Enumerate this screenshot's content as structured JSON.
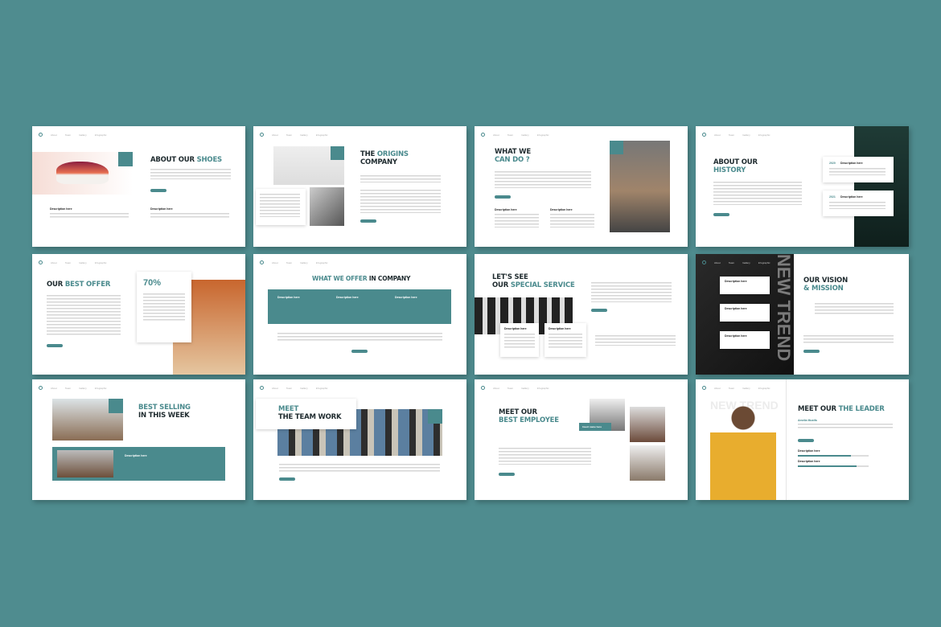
{
  "colors": {
    "background": "#4f8c8f",
    "accent": "#4a8a8d",
    "text": "#1e2a2e"
  },
  "nav": [
    "About",
    "Team",
    "Gallery",
    "Infographic"
  ],
  "slides": [
    {
      "title_a": "ABOUT OUR ",
      "title_b": "SHOES",
      "desc1": "Description here",
      "desc2": "Description here"
    },
    {
      "title_a": "THE ",
      "title_b": "ORIGINS",
      "title_c": "COMPANY"
    },
    {
      "title_a": "WHAT WE",
      "title_b": "CAN DO ?",
      "desc1": "Description here",
      "desc2": "Description here"
    },
    {
      "title_a": "ABOUT OUR",
      "title_b": "HISTORY",
      "year1": "2020",
      "year2": "2021",
      "desc": "Description here"
    },
    {
      "title_a": "OUR ",
      "title_b": "BEST OFFER",
      "stat": "70%"
    },
    {
      "title_a": "WHAT WE OFFER ",
      "title_b": "IN COMPANY",
      "desc": "Description here"
    },
    {
      "title_a": "LET'S SEE",
      "title_b": "OUR ",
      "title_c": "SPECIAL SERVICE",
      "desc": "Description here"
    },
    {
      "title_a": "OUR VISION",
      "title_b": "& MISSION",
      "desc": "Description here",
      "watermark": "NEW TREND"
    },
    {
      "title_a": "BEST SELLING",
      "title_b": "IN THIS WEEK",
      "desc": "Description here"
    },
    {
      "title_a": "MEET",
      "title_b": "THE TEAM WORK"
    },
    {
      "title_a": "MEET OUR",
      "title_b": "BEST EMPLOYEE",
      "badge": "Insert name here"
    },
    {
      "title_a": "MEET OUR ",
      "title_b": "THE LEADER",
      "name": "Amelia Mustfa",
      "watermark": "NEW TREND",
      "desc": "Description here",
      "progress": [
        0.75,
        0.83
      ]
    }
  ]
}
